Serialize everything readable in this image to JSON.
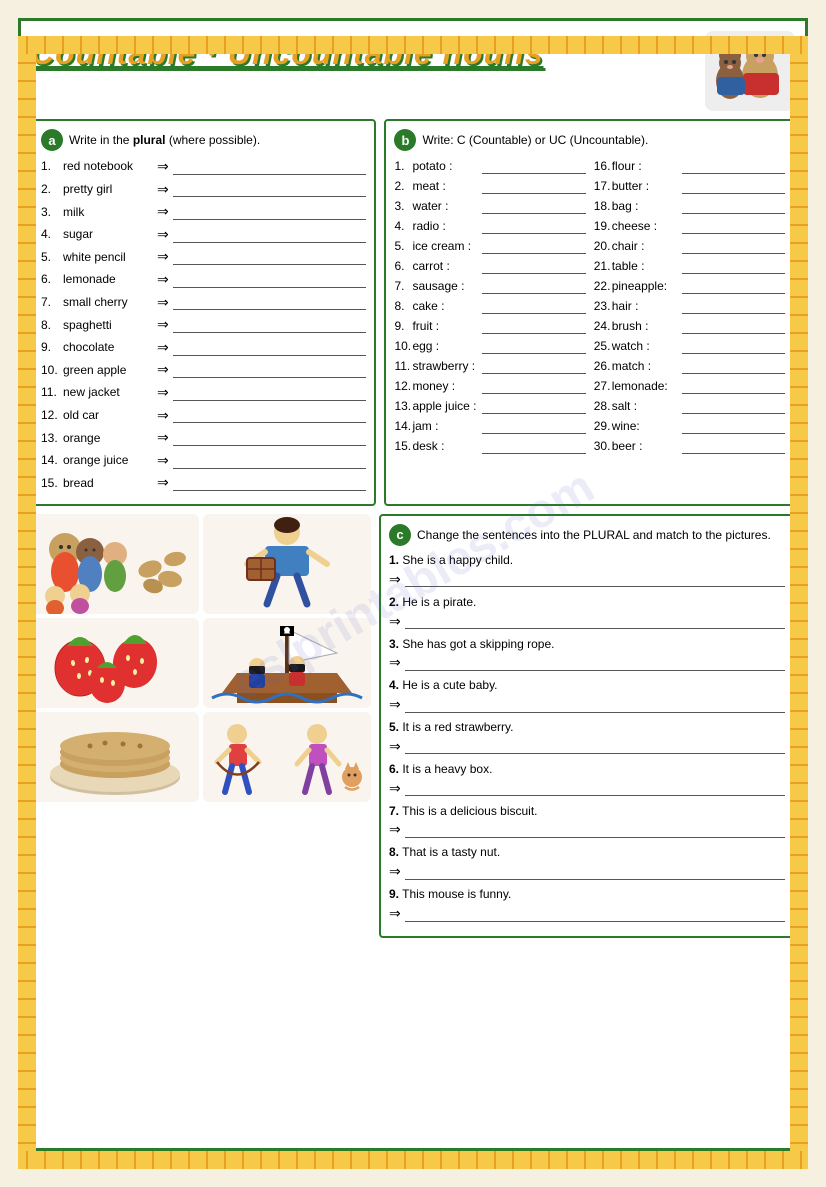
{
  "title": "Countable · Uncountable nouns",
  "sectionA": {
    "label": "a",
    "instruction": "Write in the ",
    "instruction_bold": "plural",
    "instruction_end": " (where possible).",
    "items": [
      {
        "num": "1.",
        "text": "red notebook"
      },
      {
        "num": "2.",
        "text": "pretty girl"
      },
      {
        "num": "3.",
        "text": "milk"
      },
      {
        "num": "4.",
        "text": "sugar"
      },
      {
        "num": "5.",
        "text": "white pencil"
      },
      {
        "num": "6.",
        "text": "lemonade"
      },
      {
        "num": "7.",
        "text": "small cherry"
      },
      {
        "num": "8.",
        "text": "spaghetti"
      },
      {
        "num": "9.",
        "text": "chocolate"
      },
      {
        "num": "10.",
        "text": "green apple"
      },
      {
        "num": "11.",
        "text": "new jacket"
      },
      {
        "num": "12.",
        "text": "old car"
      },
      {
        "num": "13.",
        "text": "orange"
      },
      {
        "num": "14.",
        "text": "orange juice"
      },
      {
        "num": "15.",
        "text": "bread"
      }
    ]
  },
  "sectionB": {
    "label": "b",
    "instruction": "Write: C (Countable) or UC (Uncountable).",
    "items_col1": [
      {
        "num": "1.",
        "text": "potato :"
      },
      {
        "num": "2.",
        "text": "meat :"
      },
      {
        "num": "3.",
        "text": "water :"
      },
      {
        "num": "4.",
        "text": "radio :"
      },
      {
        "num": "5.",
        "text": "ice cream :"
      },
      {
        "num": "6.",
        "text": "carrot :"
      },
      {
        "num": "7.",
        "text": "sausage :"
      },
      {
        "num": "8.",
        "text": "cake :"
      },
      {
        "num": "9.",
        "text": "fruit :"
      },
      {
        "num": "10.",
        "text": "egg :"
      },
      {
        "num": "11.",
        "text": "strawberry :"
      },
      {
        "num": "12.",
        "text": "money :"
      },
      {
        "num": "13.",
        "text": "apple juice :"
      },
      {
        "num": "14.",
        "text": "jam :"
      },
      {
        "num": "15.",
        "text": "desk :"
      }
    ],
    "items_col2": [
      {
        "num": "16.",
        "text": "flour :"
      },
      {
        "num": "17.",
        "text": "butter :"
      },
      {
        "num": "18.",
        "text": "bag :"
      },
      {
        "num": "19.",
        "text": "cheese :"
      },
      {
        "num": "20.",
        "text": "chair :"
      },
      {
        "num": "21.",
        "text": "table :"
      },
      {
        "num": "22.",
        "text": "pineapple:"
      },
      {
        "num": "23.",
        "text": "hair :"
      },
      {
        "num": "24.",
        "text": "brush :"
      },
      {
        "num": "25.",
        "text": "watch :"
      },
      {
        "num": "26.",
        "text": "match :"
      },
      {
        "num": "27.",
        "text": "lemonade:"
      },
      {
        "num": "28.",
        "text": "salt :"
      },
      {
        "num": "29.",
        "text": "wine:"
      },
      {
        "num": "30.",
        "text": "beer :"
      }
    ]
  },
  "sectionC": {
    "label": "c",
    "instruction": "Change the sentences into the PLURAL and match to the pictures.",
    "sentences": [
      {
        "num": "1.",
        "text": "She is a happy child."
      },
      {
        "num": "2.",
        "text": "He is a pirate."
      },
      {
        "num": "3.",
        "text": "She has got a skipping rope."
      },
      {
        "num": "4.",
        "text": "He is a cute baby."
      },
      {
        "num": "5.",
        "text": "It is a red strawberry."
      },
      {
        "num": "6.",
        "text": "It is a heavy box."
      },
      {
        "num": "7.",
        "text": "This is a delicious biscuit."
      },
      {
        "num": "8.",
        "text": "That is a tasty nut."
      },
      {
        "num": "9.",
        "text": "This mouse is funny."
      }
    ]
  },
  "watermark": "eslprintables.com"
}
